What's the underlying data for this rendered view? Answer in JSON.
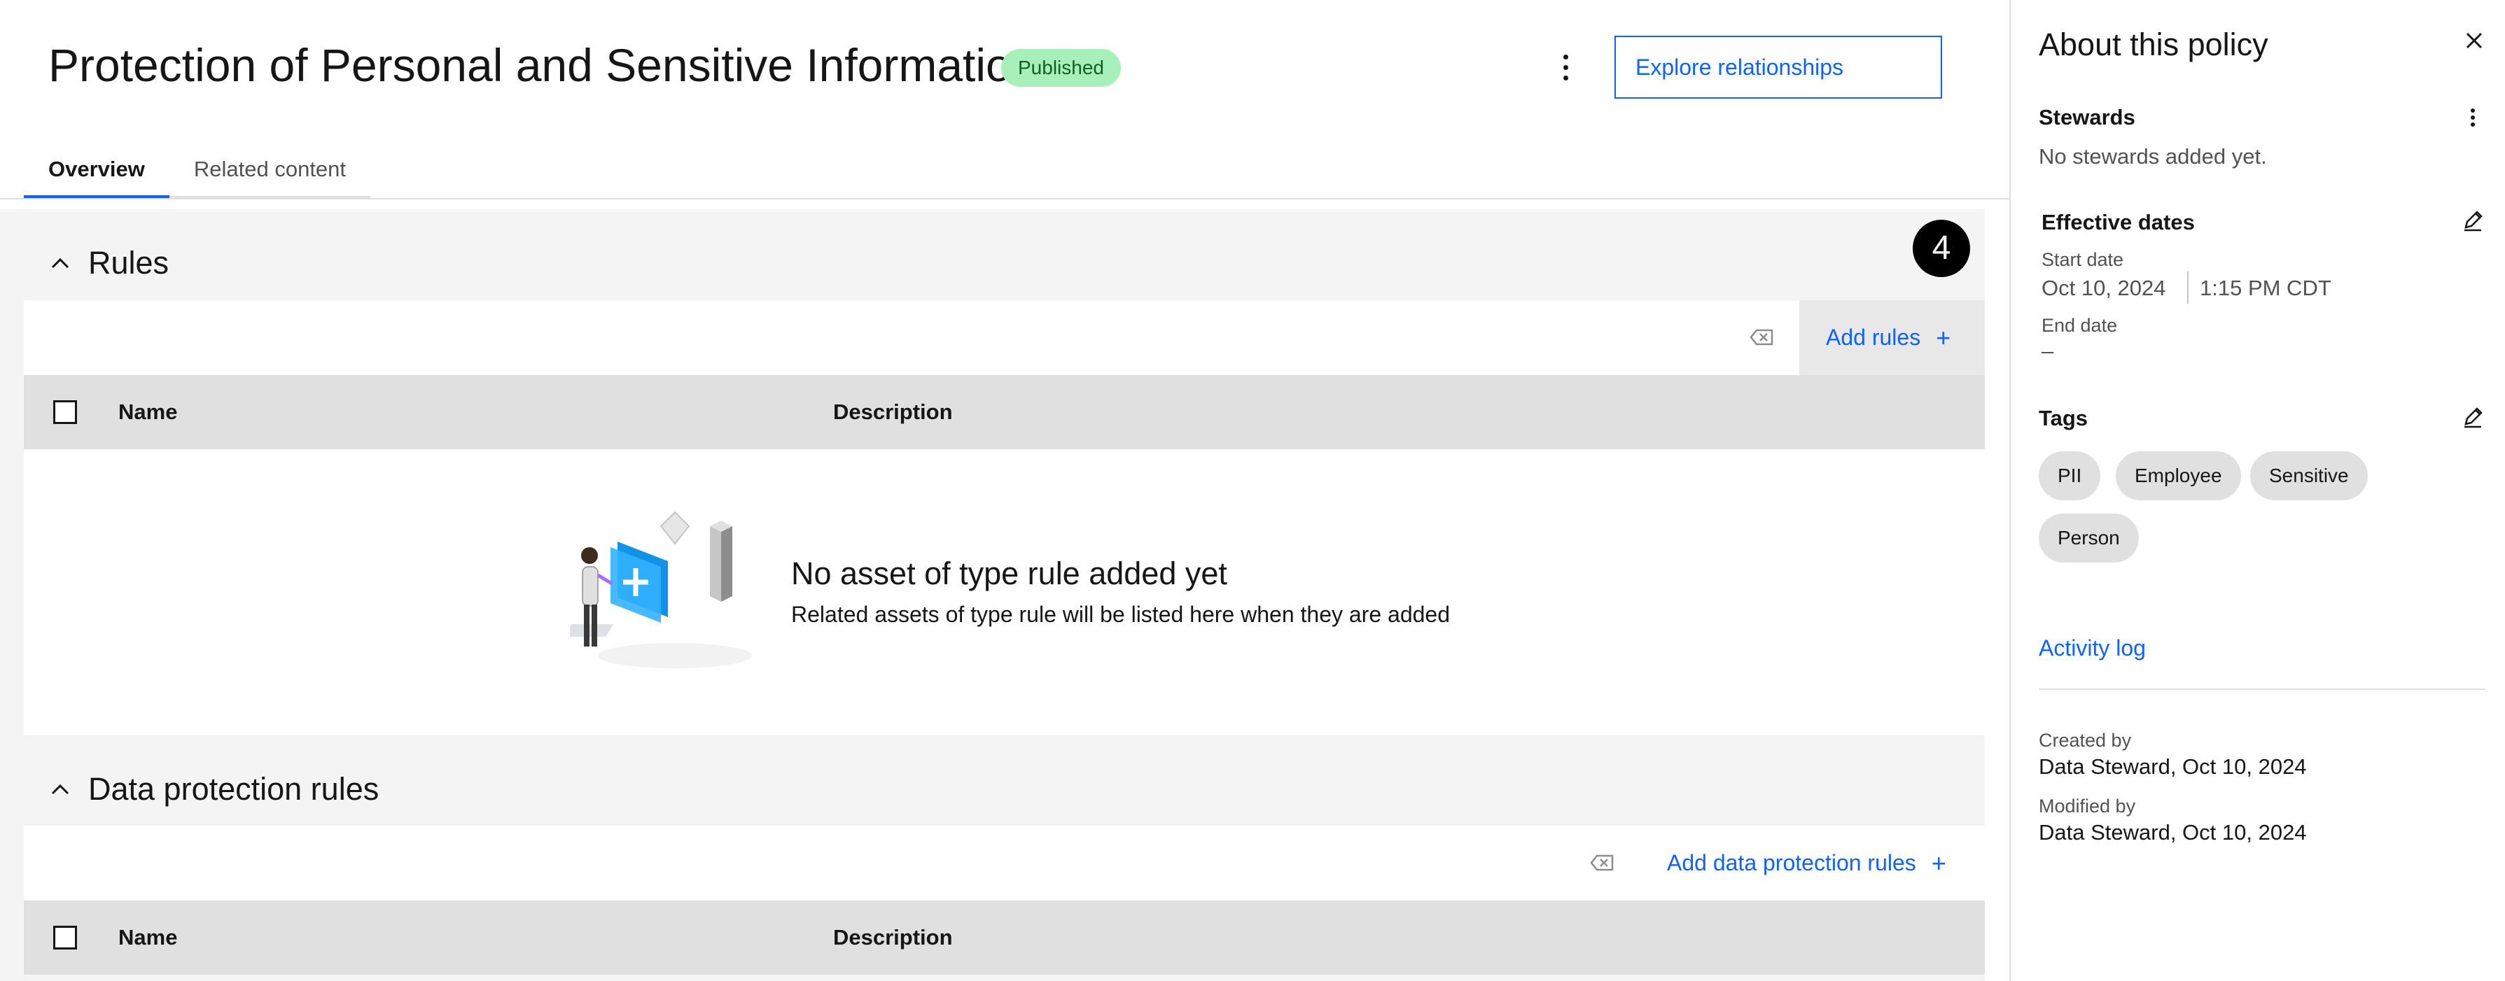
{
  "header": {
    "title": "Protection of Personal and Sensitive Information",
    "status_badge": "Published",
    "explore_button": "Explore relationships",
    "overflow_icon": "overflow-menu-vertical-icon"
  },
  "tabs": [
    {
      "label": "Overview",
      "active": true
    },
    {
      "label": "Related content",
      "active": false
    }
  ],
  "step_marker": "4",
  "sections": {
    "rules": {
      "title": "Rules",
      "add_label": "Add rules",
      "add_icon": "+",
      "columns": {
        "name": "Name",
        "description": "Description"
      },
      "empty_title": "No asset of type rule added yet",
      "empty_subtitle": "Related assets of type rule will be listed here when they are added"
    },
    "data_protection_rules": {
      "title": "Data protection rules",
      "add_label": "Add data protection rules",
      "add_icon": "+",
      "columns": {
        "name": "Name",
        "description": "Description"
      }
    }
  },
  "panel": {
    "title": "About this policy",
    "stewards": {
      "heading": "Stewards",
      "empty": "No stewards added yet."
    },
    "effective_dates": {
      "heading": "Effective dates",
      "start_label": "Start date",
      "start_date": "Oct 10, 2024",
      "start_time": "1:15 PM CDT",
      "end_label": "End date",
      "end_value": "–"
    },
    "tags": {
      "heading": "Tags",
      "items": [
        "PII",
        "Employee",
        "Sensitive",
        "Person"
      ]
    },
    "activity_log": "Activity log",
    "created_by": {
      "label": "Created by",
      "value": "Data Steward, Oct 10, 2024"
    },
    "modified_by": {
      "label": "Modified by",
      "value": "Data Steward, Oct 10, 2024"
    }
  },
  "colors": {
    "accent": "#0f62fe",
    "badge_bg": "#a7f0ba",
    "badge_text": "#0e6027",
    "content_bg": "#f4f4f4",
    "table_header_bg": "#e0e0e0"
  }
}
